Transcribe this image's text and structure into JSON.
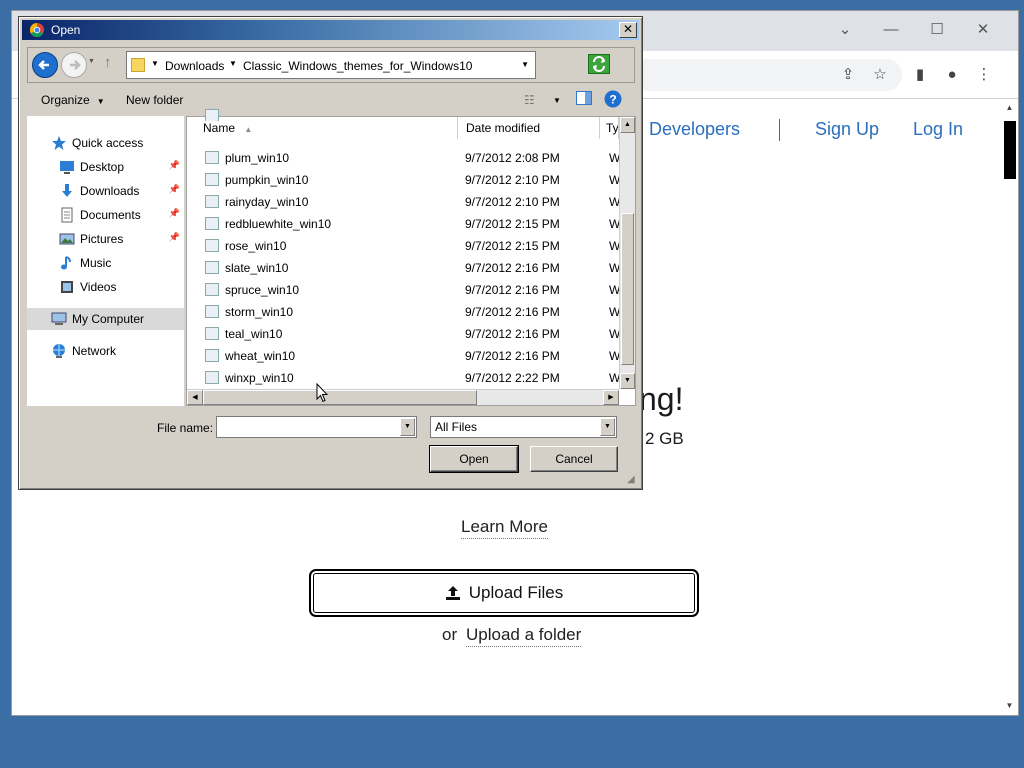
{
  "colors": {
    "desktop": "#3a6ea5",
    "link": "#2a6ebd",
    "title_bar_start": "#0a246a"
  },
  "browser": {
    "nav_links": [
      "Developers",
      "Sign Up",
      "Log In"
    ],
    "hero_text_partial": "ng!",
    "hero_sub_partial": "2 GB",
    "learn_more": "Learn More",
    "upload_files": "Upload Files",
    "or_text": "or",
    "upload_folder": "Upload a folder",
    "icons": [
      "share-icon",
      "star-icon",
      "side-panel-icon",
      "profile-icon",
      "more-icon",
      "minimize-icon",
      "maximize-icon",
      "close-icon",
      "tab-dropdown-icon"
    ]
  },
  "dialog": {
    "title": "Open",
    "breadcrumb": [
      "Downloads",
      "Classic_Windows_themes_for_Windows10"
    ],
    "toolbar": {
      "organize": "Organize",
      "new_folder": "New folder"
    },
    "nav_pane": {
      "quick_access": "Quick access",
      "quick_items": [
        "Desktop",
        "Downloads",
        "Documents",
        "Pictures",
        "Music",
        "Videos"
      ],
      "my_computer": "My Computer",
      "network": "Network"
    },
    "columns": {
      "name": "Name",
      "date_modified": "Date modified",
      "type": "Ty"
    },
    "files": [
      {
        "name": "plum_win10",
        "date": "9/7/2012 2:08 PM",
        "type": "W"
      },
      {
        "name": "pumpkin_win10",
        "date": "9/7/2012 2:10 PM",
        "type": "W"
      },
      {
        "name": "rainyday_win10",
        "date": "9/7/2012 2:10 PM",
        "type": "W"
      },
      {
        "name": "redbluewhite_win10",
        "date": "9/7/2012 2:15 PM",
        "type": "W"
      },
      {
        "name": "rose_win10",
        "date": "9/7/2012 2:15 PM",
        "type": "W"
      },
      {
        "name": "slate_win10",
        "date": "9/7/2012 2:16 PM",
        "type": "W"
      },
      {
        "name": "spruce_win10",
        "date": "9/7/2012 2:16 PM",
        "type": "W"
      },
      {
        "name": "storm_win10",
        "date": "9/7/2012 2:16 PM",
        "type": "W"
      },
      {
        "name": "teal_win10",
        "date": "9/7/2012 2:16 PM",
        "type": "W"
      },
      {
        "name": "wheat_win10",
        "date": "9/7/2012 2:16 PM",
        "type": "W"
      },
      {
        "name": "winxp_win10",
        "date": "9/7/2012 2:22 PM",
        "type": "W"
      }
    ],
    "file_name_label": "File name:",
    "file_name_value": "",
    "file_type": "All Files",
    "open_button": "Open",
    "cancel_button": "Cancel"
  }
}
